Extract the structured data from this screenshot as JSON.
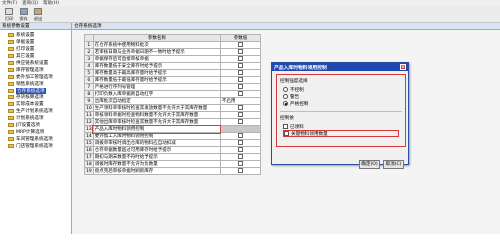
{
  "menu": [
    "文件(F)",
    "查询(Q)",
    "帮助(H)"
  ],
  "toolbar": [
    {
      "label": "打印",
      "icon": "print-icon"
    },
    {
      "label": "保存",
      "icon": "save-icon"
    },
    {
      "label": "退出",
      "icon": "exit-icon"
    }
  ],
  "left_pane": {
    "title": "系统参数设置",
    "items": [
      "系统设置",
      "单据设置",
      "打印设置",
      "其它设置",
      "供应链系统设置",
      "库存管理选项",
      "委外加工管理选项",
      "销售系统选项",
      "仓存系统选项",
      "存货核算选项",
      "实际成本设置",
      "生产计划系统选项",
      "计划系统选项",
      "JIT设置选项",
      "MRP计算选项",
      "车间管理系统选项",
      "门店管理系统选项"
    ],
    "selected_index": 8
  },
  "right_pane": {
    "title": "仓存系统选项",
    "columns": [
      "",
      "参数名称",
      "参数值"
    ],
    "rows": [
      {
        "num": "1",
        "name": "在仓存系统中使用物料批次",
        "value": "checkbox"
      },
      {
        "num": "2",
        "name": "若审核日期与业务单据日期不一致时给予提示",
        "value": "checkbox"
      },
      {
        "num": "3",
        "name": "单据保存后可直接审核单据",
        "value": "checkbox"
      },
      {
        "num": "4",
        "name": "库存数量低于安全库存时给予提示",
        "value": "checkbox"
      },
      {
        "num": "5",
        "name": "库存数量高于最高库存量时给予提示",
        "value": "checkbox"
      },
      {
        "num": "6",
        "name": "库存数量低于最低库存量时给予提示",
        "value": "checkbox"
      },
      {
        "num": "7",
        "name": "严格进行序列号管理",
        "value": "checkbox"
      },
      {
        "num": "8",
        "name": "打印负数入库单据则自动红字",
        "value": "checkbox"
      },
      {
        "num": "9",
        "name": "出库批次自动指定",
        "value": "不启用"
      },
      {
        "num": "10",
        "name": "生产领料单审核时检查其发放数量不允许大于其库存数量",
        "value": "checkbox"
      },
      {
        "num": "11",
        "name": "审核领料单据时检查物料数量不允许大于其库存数量",
        "value": "checkbox"
      },
      {
        "num": "12",
        "name": "其他出库单审核时检查其数量不允许大于其库存数量",
        "value": "checkbox"
      },
      {
        "num": "13",
        "name": "产品入库时物料领用控制",
        "value": ""
      },
      {
        "num": "14",
        "name": "委外加工入库时物料领用控制",
        "value": "checkbox"
      },
      {
        "num": "15",
        "name": "调拨单审核时调出仓库的物料应自动扣减",
        "value": "checkbox"
      },
      {
        "num": "16",
        "name": "仓存单据数量超过可用库存时给予提示",
        "value": "checkbox"
      },
      {
        "num": "17",
        "name": "期初与期末数量不符时给予提示",
        "value": "checkbox"
      },
      {
        "num": "18",
        "name": "调拨时库存数量不允许为负数量",
        "value": "checkbox"
      },
      {
        "num": "19",
        "name": "盘点完后审核单据时刷新库存",
        "value": "checkbox"
      }
    ],
    "highlighted_row": 12
  },
  "dialog": {
    "title": "产品入库时物料领用控制",
    "group1_label": "控制强度选择",
    "group1_options": [
      "不控制",
      "警告",
      "严格控制"
    ],
    "group1_selected": 2,
    "group2_label": "控制依",
    "group2_options": [
      "已领料",
      "关键物料领用数量"
    ],
    "group2_checked": [
      false,
      false
    ],
    "ok_label": "确定(O)",
    "cancel_label": "取消(C)"
  }
}
